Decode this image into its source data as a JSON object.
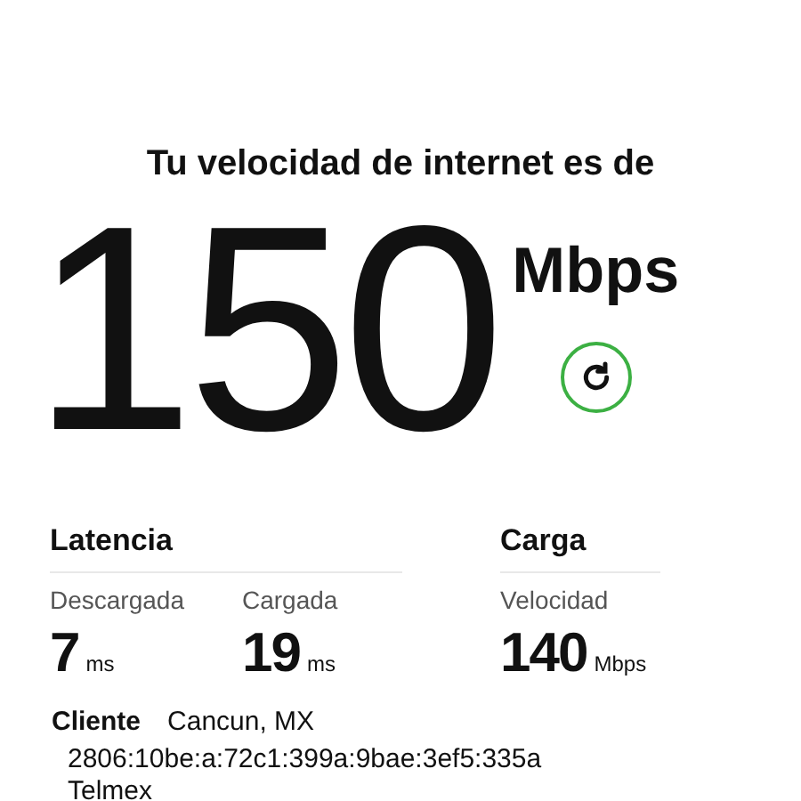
{
  "heading": "Tu velocidad de internet es de",
  "speed": {
    "value": "150",
    "unit": "Mbps"
  },
  "sections": [
    {
      "title": "Latencia",
      "metrics": [
        {
          "label": "Descargada",
          "value": "7",
          "unit": "ms"
        },
        {
          "label": "Cargada",
          "value": "19",
          "unit": "ms"
        }
      ]
    },
    {
      "title": "Carga",
      "metrics": [
        {
          "label": "Velocidad",
          "value": "140",
          "unit": "Mbps"
        }
      ]
    }
  ],
  "client": {
    "label": "Cliente",
    "location": "Cancun, MX",
    "ip": "2806:10be:a:72c1:399a:9bae:3ef5:335a",
    "isp": "Telmex"
  }
}
